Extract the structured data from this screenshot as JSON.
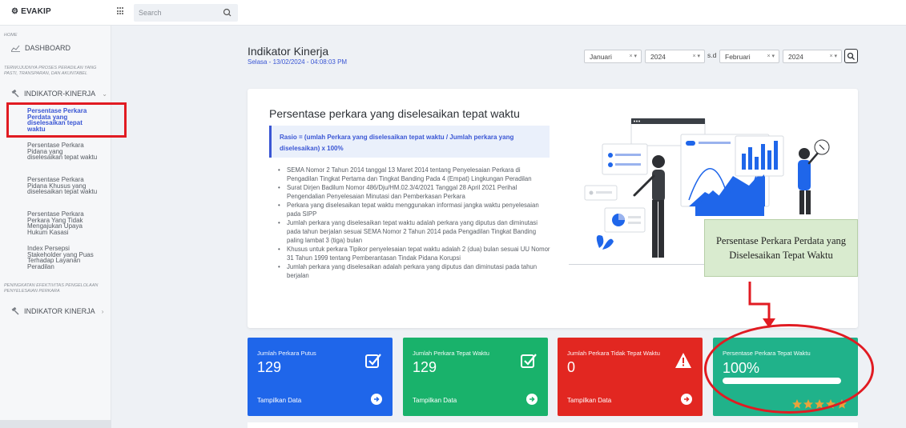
{
  "app": {
    "brand": "EVAKIP"
  },
  "search": {
    "placeholder": "Search"
  },
  "sidebar": {
    "home_label": "HOME",
    "dashboard": "DASHBOARD",
    "section1": "TERWUJUDNYA PROSES PERADILAN YANG PASTI, TRANSPARAN, DAN AKUNTABEL",
    "indikator1": "INDIKATOR-KINERJA",
    "sub_items": [
      "Persentase Perkara Perdata yang diselesaikan tepat waktu",
      "Persentase Perkara Pidana yang diselesaikan tepat waktu",
      "Persentase Perkara Pidana Khusus yang diselesaikan tepat waktu",
      "Persentase Perkara Perkara Yang Tidak Mengajukan Upaya Hukum Kasasi",
      "Index Persepsi Stakeholder yang Puas Terhadap Layanan Peradilan"
    ],
    "section2": "PENINGKATAN EFEKTIVITAS PENGELOLAAN PENYELESAIAN PERKARA",
    "indikator2": "INDIKATOR KINERJA"
  },
  "header": {
    "title": "Indikator Kinerja",
    "date": "Selasa - 13/02/2024 - 04:08:03 PM"
  },
  "filters": {
    "month_from": "Januari",
    "year_from": "2024",
    "sd": "s.d",
    "month_to": "Februari",
    "year_to": "2024",
    "clear": "× ▾"
  },
  "card": {
    "title": "Persentase perkara yang diselesaikan tepat waktu",
    "rasio": "Rasio = (umlah Perkara yang diselesaikan tepat waktu / Jumlah perkara yang diselesaikan) x 100%",
    "bullets": [
      "SEMA Nomor 2 Tahun 2014 tanggal 13 Maret 2014 tentang Penyelesaian Perkara di Pengadilan Tingkat Pertama dan Tingkat Banding Pada 4 (Empat) Lingkungan Peradilan",
      "Surat Dirjen Badilum Nomor 486/Dju/HM.02.3/4/2021 Tanggal 28 April 2021 Perihal Pengendalian Penyelesaian Minutasi dan Pemberkasan Perkara",
      "Perkara yang diselesaikan tepat waktu menggunakan informasi jangka waktu penyelesaian pada SIPP",
      "Jumlah perkara yang diselesaikan tepat waktu adalah perkara yang diputus dan diminutasi pada tahun berjalan sesuai SEMA Nomor 2 Tahun 2014 pada Pengadilan Tingkat Banding paling lambat 3 (tiga) bulan",
      "Khusus untuk perkara Tipikor penyelesaian tepat waktu adalah 2 (dua) bulan sesuai UU Nomor 31 Tahun 1999 tentang Pemberantasan Tindak Pidana Korupsi",
      "Jumlah perkara yang diselesaikan adalah perkara yang diputus dan diminutasi pada tahun berjalan"
    ]
  },
  "callout": {
    "text": "Persentase Perkara Perdata yang Diselesaikan Tepat Waktu"
  },
  "stats": [
    {
      "label": "Jumlah Perkara Putus",
      "value": "129",
      "action": "Tampilkan Data",
      "color": "#1f66ea"
    },
    {
      "label": "Jumlah Perkara Tepat Waktu",
      "value": "129",
      "action": "Tampilkan Data",
      "color": "#19b26b"
    },
    {
      "label": "Jumlah Perkara Tidak Tepat Waktu",
      "value": "0",
      "action": "Tampilkan Data",
      "color": "#e22721"
    },
    {
      "label": "Persentase Perkara Tepat Waktu",
      "value": "100%",
      "progress": 1.0,
      "stars": 5,
      "color": "#20b28a"
    }
  ]
}
